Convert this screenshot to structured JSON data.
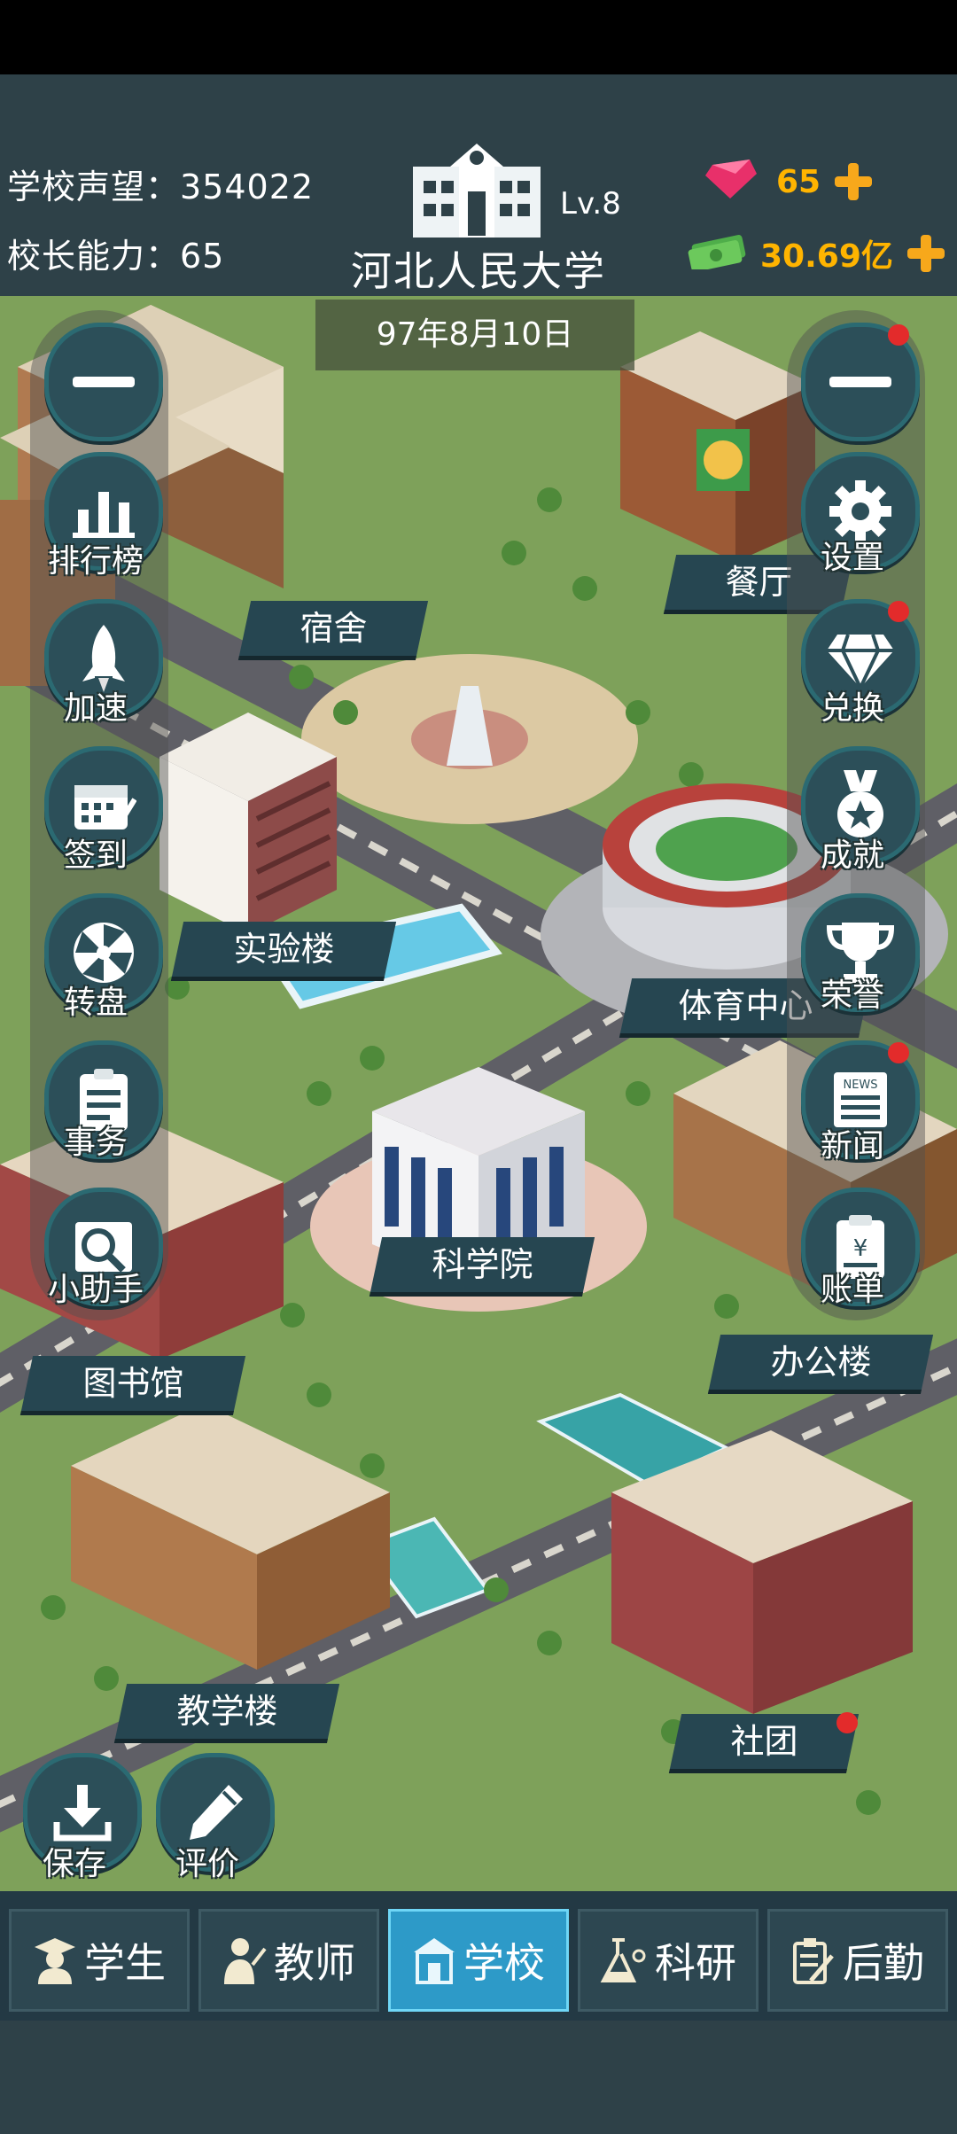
{
  "header": {
    "reputation_label": "学校声望：354022",
    "ability_label": "校长能力：65",
    "school_name": "河北人民大学",
    "level": "Lv.8",
    "gems": "65",
    "money": "30.69亿",
    "date": "97年8月10日"
  },
  "left_menu": [
    {
      "id": "collapse",
      "label": "",
      "icon": "minus-icon"
    },
    {
      "id": "rank",
      "label": "排行榜",
      "icon": "bar-chart-icon"
    },
    {
      "id": "speed",
      "label": "加速",
      "icon": "rocket-icon"
    },
    {
      "id": "checkin",
      "label": "签到",
      "icon": "calendar-icon"
    },
    {
      "id": "wheel",
      "label": "转盘",
      "icon": "wheel-icon"
    },
    {
      "id": "affairs",
      "label": "事务",
      "icon": "clipboard-icon"
    },
    {
      "id": "helper",
      "label": "小助手",
      "icon": "magnifier-icon"
    }
  ],
  "right_menu": [
    {
      "id": "collapse",
      "label": "",
      "icon": "minus-icon"
    },
    {
      "id": "settings",
      "label": "设置",
      "icon": "gear-icon"
    },
    {
      "id": "exchange",
      "label": "兑换",
      "icon": "diamond-icon"
    },
    {
      "id": "achieve",
      "label": "成就",
      "icon": "medal-icon"
    },
    {
      "id": "honor",
      "label": "荣誉",
      "icon": "trophy-icon"
    },
    {
      "id": "news",
      "label": "新闻",
      "icon": "newspaper-icon"
    },
    {
      "id": "bill",
      "label": "账单",
      "icon": "bill-icon"
    }
  ],
  "buildings": {
    "dorm": "宿舍",
    "canteen": "餐厅",
    "lab": "实验楼",
    "sports": "体育中心",
    "science": "科学院",
    "library": "图书馆",
    "office": "办公楼",
    "teaching": "教学楼",
    "club": "社团"
  },
  "bottom_left": {
    "save": "保存",
    "rate": "评价"
  },
  "nav": [
    {
      "id": "students",
      "label": "学生",
      "icon": "student-icon"
    },
    {
      "id": "teachers",
      "label": "教师",
      "icon": "teacher-icon"
    },
    {
      "id": "school",
      "label": "学校",
      "icon": "school-icon"
    },
    {
      "id": "research",
      "label": "科研",
      "icon": "flask-icon"
    },
    {
      "id": "logistics",
      "label": "后勤",
      "icon": "logistics-icon"
    }
  ],
  "colors": {
    "gold": "#ffb400",
    "active_tab": "#2d9ac8",
    "badge": "#e32b2b"
  }
}
